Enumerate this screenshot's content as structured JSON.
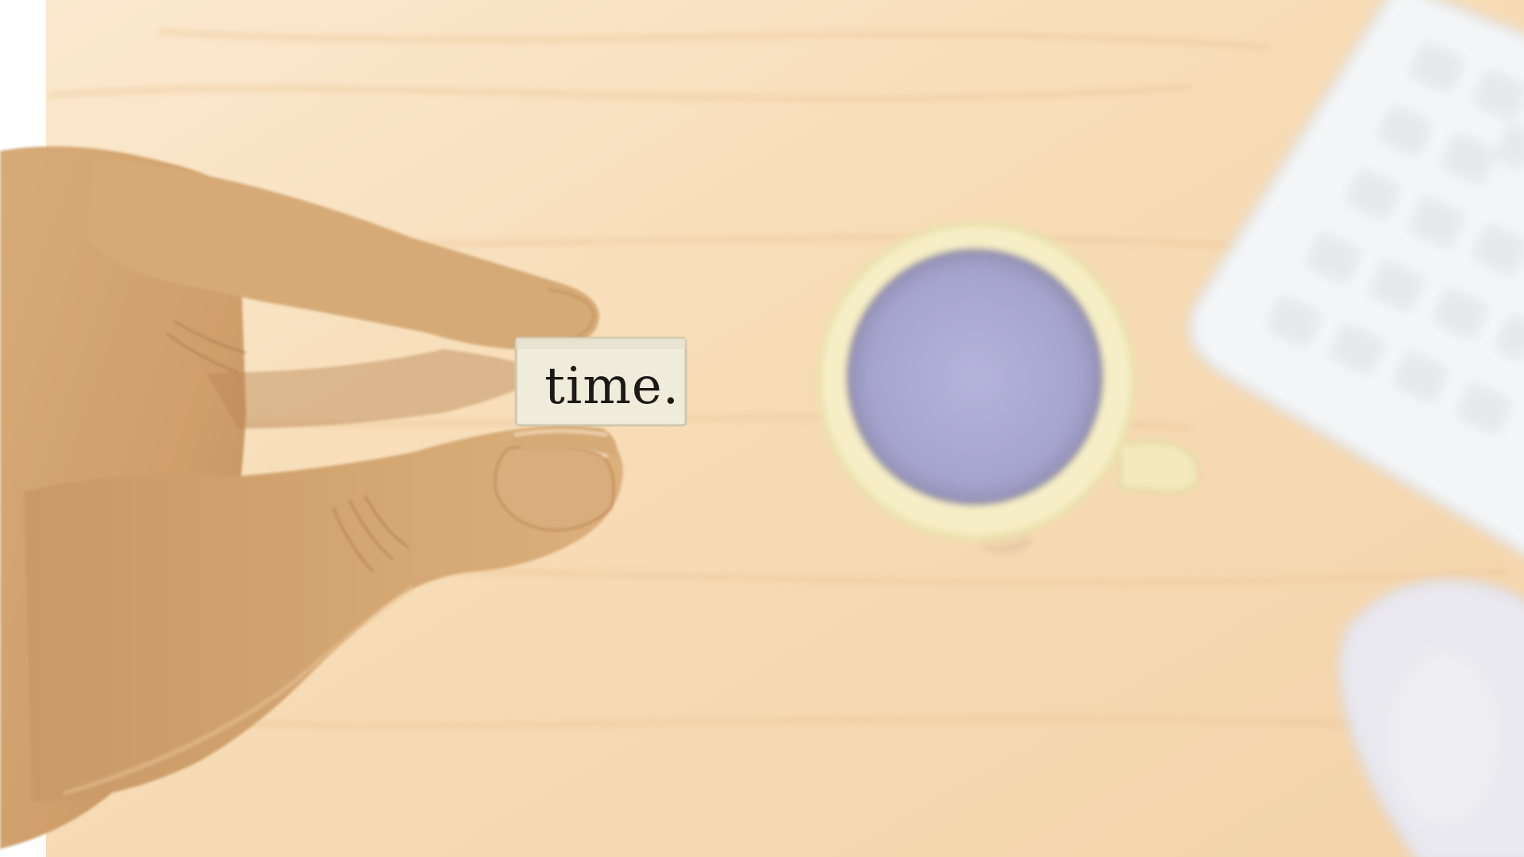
{
  "image": {
    "word_on_paper": "time."
  },
  "colors": {
    "desk": "#f6ddb8",
    "desk_light": "#fae8cb",
    "desk_grain": "#ecc99c",
    "skin": "#d8ab76",
    "skin_shadow": "#b88756",
    "paper": "#f1eedd",
    "mug": "#f5ecc2",
    "coffee": "#aaa9d3",
    "keyboard": "#f5f6f7",
    "mouse": "#e9e8ee"
  }
}
